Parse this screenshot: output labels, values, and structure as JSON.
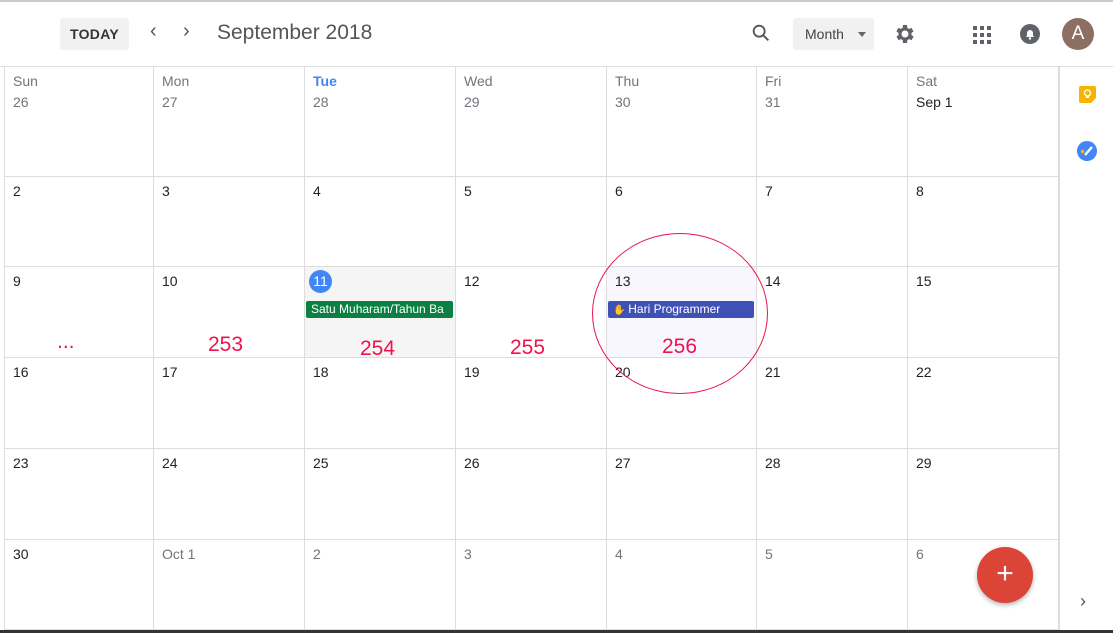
{
  "header": {
    "today_label": "TODAY",
    "prev": "‹",
    "next": "›",
    "title": "September 2018",
    "view": "Month",
    "avatar_letter": "A"
  },
  "day_names": [
    "Sun",
    "Mon",
    "Tue",
    "Wed",
    "Thu",
    "Fri",
    "Sat"
  ],
  "current_day_index": 2,
  "weeks": [
    [
      "26",
      "27",
      "28",
      "29",
      "30",
      "31",
      "Sep 1"
    ],
    [
      "2",
      "3",
      "4",
      "5",
      "6",
      "7",
      "8"
    ],
    [
      "9",
      "10",
      "11",
      "12",
      "13",
      "14",
      "15"
    ],
    [
      "16",
      "17",
      "18",
      "19",
      "20",
      "21",
      "22"
    ],
    [
      "23",
      "24",
      "25",
      "26",
      "27",
      "28",
      "29"
    ],
    [
      "30",
      "Oct 1",
      "2",
      "3",
      "4",
      "5",
      "6"
    ]
  ],
  "events": [
    {
      "week": 2,
      "day": 2,
      "title": "Satu Muharam/Tahun Ba",
      "color": "#0b8043"
    },
    {
      "week": 2,
      "day": 4,
      "title": "Hari Programmer",
      "color": "#3f51b5",
      "icon": "hand-icon"
    }
  ],
  "annotations": [
    "...",
    "253",
    "254",
    "255",
    "256"
  ],
  "colors": {
    "accent": "#4285f4",
    "annotation": "#f0124a",
    "fab": "#db4437"
  },
  "fab_label": "+"
}
